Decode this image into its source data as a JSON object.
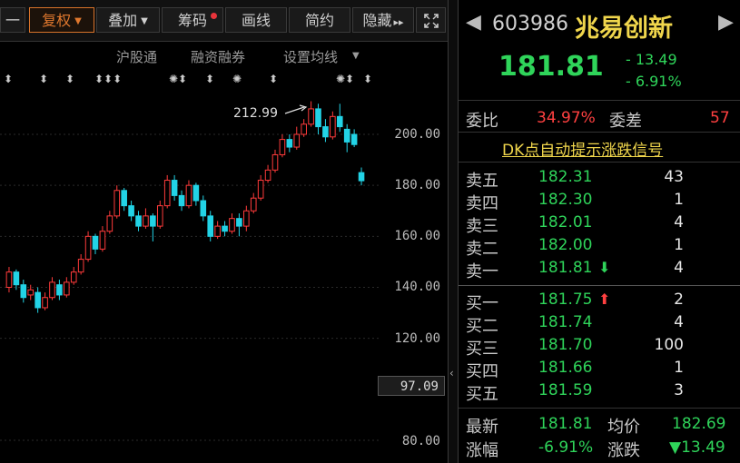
{
  "toolbar": {
    "first": "一",
    "fuquan": "复权",
    "diejia": "叠加",
    "chouma": "筹码",
    "huaxian": "画线",
    "jianyue": "简约",
    "yincang": "隐藏",
    "yincang_arrows": "▸▸",
    "expand_icon": "expand-icon"
  },
  "subbar": {
    "hugutong": "沪股通",
    "rongzi": "融资融券",
    "junxian": "设置均线"
  },
  "annotation": {
    "high": "212.99"
  },
  "axis": {
    "ticks": [
      "200.00",
      "180.00",
      "160.00",
      "140.00",
      "120.00",
      "80.00"
    ],
    "current": "97.09"
  },
  "chart_data": {
    "type": "candlestick",
    "ylim": [
      75,
      220
    ],
    "candles": [
      {
        "o": 140,
        "c": 146,
        "h": 148,
        "l": 138
      },
      {
        "o": 146,
        "c": 141,
        "h": 147,
        "l": 139
      },
      {
        "o": 141,
        "c": 136,
        "h": 143,
        "l": 134
      },
      {
        "o": 137,
        "c": 139,
        "h": 141,
        "l": 135
      },
      {
        "o": 138,
        "c": 132,
        "h": 140,
        "l": 130
      },
      {
        "o": 132,
        "c": 136,
        "h": 138,
        "l": 131
      },
      {
        "o": 136,
        "c": 142,
        "h": 144,
        "l": 135
      },
      {
        "o": 141,
        "c": 137,
        "h": 143,
        "l": 135
      },
      {
        "o": 137,
        "c": 142,
        "h": 144,
        "l": 136
      },
      {
        "o": 142,
        "c": 146,
        "h": 148,
        "l": 141
      },
      {
        "o": 146,
        "c": 151,
        "h": 153,
        "l": 145
      },
      {
        "o": 151,
        "c": 160,
        "h": 162,
        "l": 150
      },
      {
        "o": 160,
        "c": 155,
        "h": 161,
        "l": 153
      },
      {
        "o": 155,
        "c": 162,
        "h": 164,
        "l": 154
      },
      {
        "o": 162,
        "c": 168,
        "h": 170,
        "l": 161
      },
      {
        "o": 168,
        "c": 178,
        "h": 180,
        "l": 167
      },
      {
        "o": 178,
        "c": 172,
        "h": 179,
        "l": 170
      },
      {
        "o": 172,
        "c": 168,
        "h": 174,
        "l": 166
      },
      {
        "o": 168,
        "c": 164,
        "h": 170,
        "l": 162
      },
      {
        "o": 164,
        "c": 168,
        "h": 171,
        "l": 163
      },
      {
        "o": 168,
        "c": 164,
        "h": 169,
        "l": 158
      },
      {
        "o": 164,
        "c": 172,
        "h": 174,
        "l": 163
      },
      {
        "o": 172,
        "c": 182,
        "h": 184,
        "l": 171
      },
      {
        "o": 182,
        "c": 176,
        "h": 184,
        "l": 174
      },
      {
        "o": 176,
        "c": 172,
        "h": 178,
        "l": 170
      },
      {
        "o": 172,
        "c": 180,
        "h": 182,
        "l": 171
      },
      {
        "o": 180,
        "c": 174,
        "h": 181,
        "l": 172
      },
      {
        "o": 174,
        "c": 168,
        "h": 176,
        "l": 166
      },
      {
        "o": 168,
        "c": 160,
        "h": 170,
        "l": 158
      },
      {
        "o": 160,
        "c": 164,
        "h": 166,
        "l": 159
      },
      {
        "o": 164,
        "c": 162,
        "h": 166,
        "l": 160
      },
      {
        "o": 162,
        "c": 167,
        "h": 169,
        "l": 161
      },
      {
        "o": 167,
        "c": 164,
        "h": 169,
        "l": 160
      },
      {
        "o": 164,
        "c": 170,
        "h": 172,
        "l": 162
      },
      {
        "o": 170,
        "c": 175,
        "h": 177,
        "l": 169
      },
      {
        "o": 175,
        "c": 182,
        "h": 184,
        "l": 174
      },
      {
        "o": 182,
        "c": 186,
        "h": 188,
        "l": 181
      },
      {
        "o": 186,
        "c": 192,
        "h": 194,
        "l": 185
      },
      {
        "o": 192,
        "c": 198,
        "h": 200,
        "l": 191
      },
      {
        "o": 198,
        "c": 195,
        "h": 200,
        "l": 193
      },
      {
        "o": 195,
        "c": 200,
        "h": 203,
        "l": 194
      },
      {
        "o": 200,
        "c": 204,
        "h": 206,
        "l": 199
      },
      {
        "o": 204,
        "c": 210,
        "h": 212.99,
        "l": 203
      },
      {
        "o": 210,
        "c": 203,
        "h": 212,
        "l": 200
      },
      {
        "o": 203,
        "c": 199,
        "h": 206,
        "l": 197
      },
      {
        "o": 199,
        "c": 207,
        "h": 209,
        "l": 198
      },
      {
        "o": 207,
        "c": 203,
        "h": 212,
        "l": 201
      },
      {
        "o": 202,
        "c": 197,
        "h": 204,
        "l": 193
      },
      {
        "o": 200,
        "c": 196,
        "h": 202,
        "l": 195
      },
      {
        "o": 185,
        "c": 181.81,
        "h": 187,
        "l": 180
      }
    ]
  },
  "stock": {
    "code": "603986",
    "name": "兆易创新",
    "price": "181.81",
    "change": "- 13.49",
    "change_pct": "- 6.91%"
  },
  "weibi": {
    "label1": "委比",
    "value1": "34.97%",
    "label2": "委差",
    "value2": "57"
  },
  "dk_link": "DK点自动提示涨跌信号",
  "asks": [
    {
      "label": "卖五",
      "price": "182.31",
      "vol": "43"
    },
    {
      "label": "卖四",
      "price": "182.30",
      "vol": "1"
    },
    {
      "label": "卖三",
      "price": "182.01",
      "vol": "4"
    },
    {
      "label": "卖二",
      "price": "182.00",
      "vol": "1"
    },
    {
      "label": "卖一",
      "price": "181.81",
      "vol": "4"
    }
  ],
  "bids": [
    {
      "label": "买一",
      "price": "181.75",
      "vol": "2"
    },
    {
      "label": "买二",
      "price": "181.74",
      "vol": "4"
    },
    {
      "label": "买三",
      "price": "181.70",
      "vol": "100"
    },
    {
      "label": "买四",
      "price": "181.66",
      "vol": "1"
    },
    {
      "label": "买五",
      "price": "181.59",
      "vol": "3"
    }
  ],
  "summary": {
    "latest_label": "最新",
    "latest_value": "181.81",
    "avg_label": "均价",
    "avg_value": "182.69",
    "zf_label": "涨幅",
    "zf_value": "-6.91%",
    "zd_label": "涨跌",
    "zd_value": "▼13.49"
  },
  "colors": {
    "up": "#ff3b3b",
    "down": "#22d3e6",
    "accent": "#f0d64c",
    "green": "#2fd45a"
  }
}
